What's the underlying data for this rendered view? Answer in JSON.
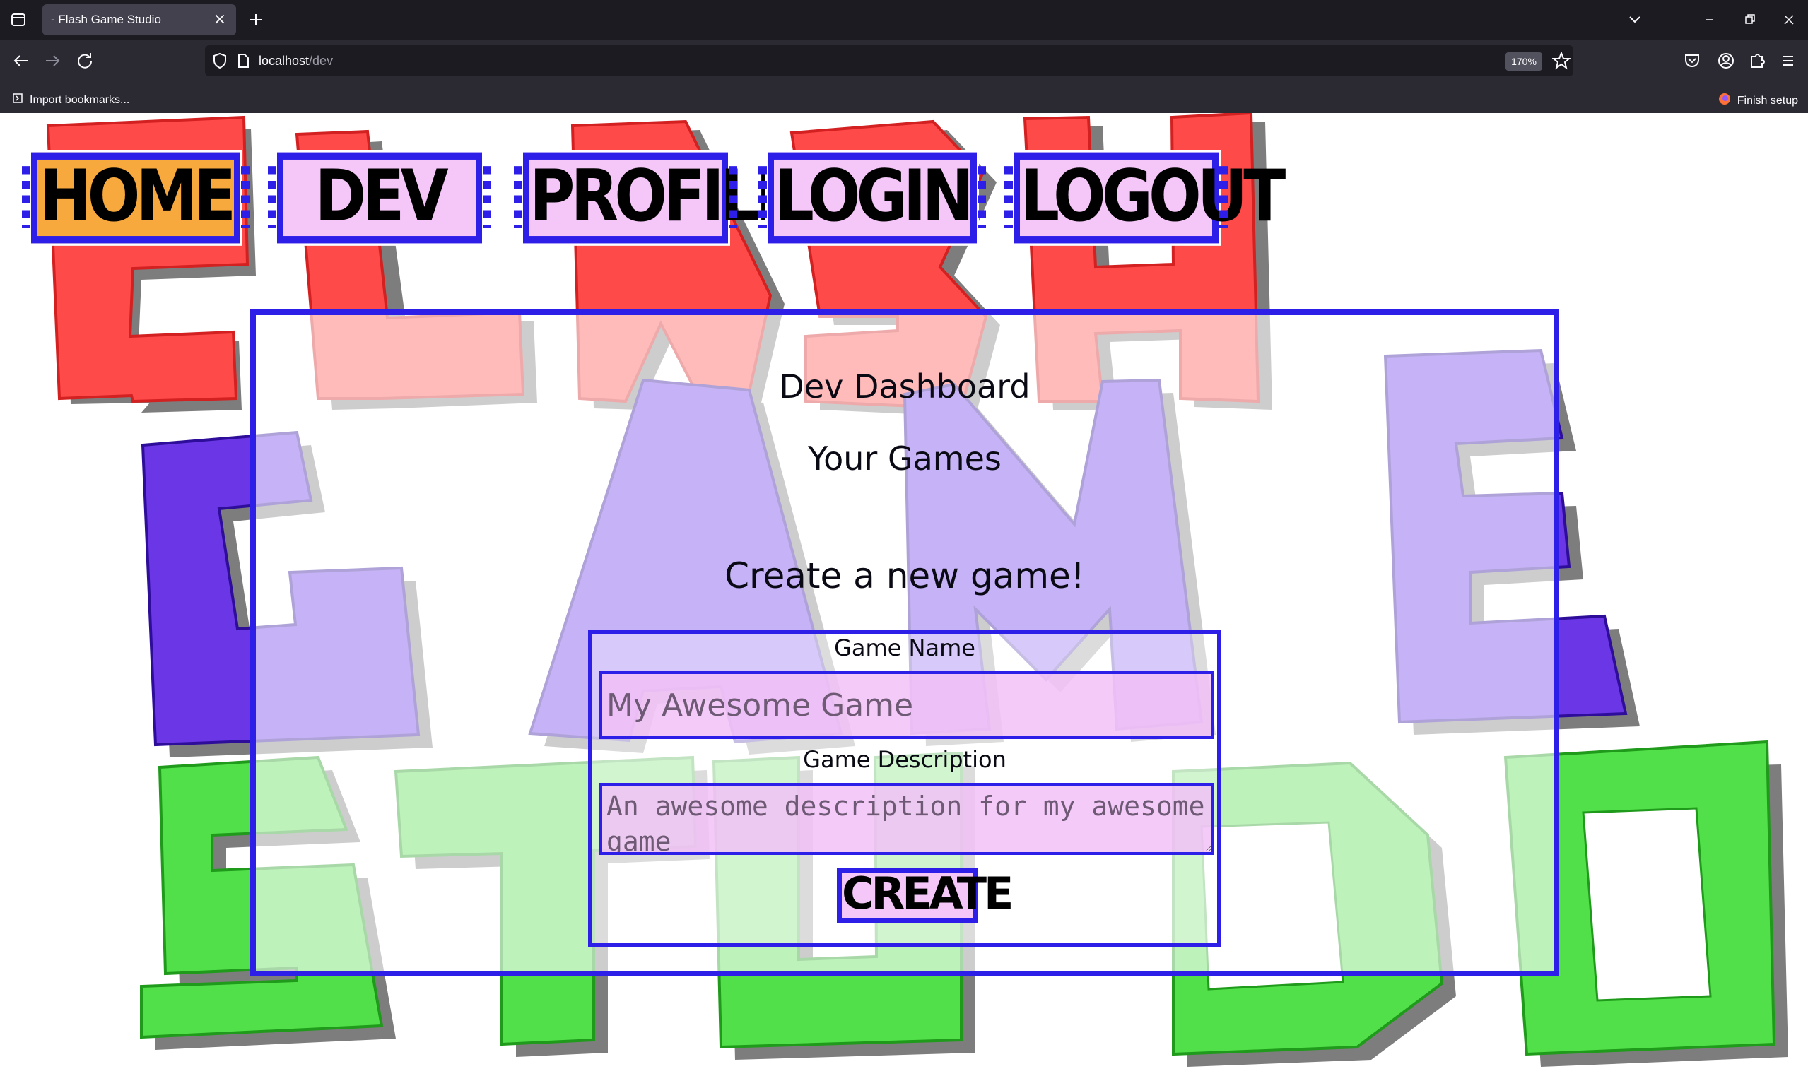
{
  "browser": {
    "tab_title": "- Flash Game Studio",
    "url_host": "localhost",
    "url_path": "/dev",
    "zoom": "170%",
    "bookmarks": {
      "import_label": "Import bookmarks...",
      "finish_setup_label": "Finish setup"
    },
    "icons": [
      "tab-list-icon",
      "close-icon",
      "plus-icon",
      "chevron-down-icon",
      "minimize-icon",
      "restore-icon",
      "window-close-icon",
      "back-arrow-icon",
      "forward-arrow-icon",
      "reload-icon",
      "shield-icon",
      "page-icon",
      "star-icon",
      "pocket-icon",
      "account-icon",
      "extensions-icon",
      "menu-icon",
      "import-icon",
      "firefox-icon"
    ]
  },
  "background": {
    "art_words": [
      "FLASH",
      "GAME",
      "STUDIO"
    ],
    "colors": {
      "flash": "#ff4a4a",
      "game": "#6a36e6",
      "studio": "#52e04a",
      "shadow": "#7d7d7d"
    }
  },
  "menu": {
    "home": "HOME",
    "dev": "DEV",
    "profile": "PROFILE",
    "login": "LOGIN",
    "logout": "LOGOUT",
    "active": "home"
  },
  "dashboard": {
    "title": "Dev Dashboard",
    "games_heading": "Your Games",
    "create_heading": "Create a new game!",
    "form": {
      "name_label": "Game Name",
      "name_placeholder": "My Awesome Game",
      "description_label": "Game Description",
      "description_placeholder": "An awesome description for my awesome game",
      "submit_label": "CREATE"
    }
  },
  "colors": {
    "accent_blue": "#2d1ee8",
    "button_pink": "#f5c6f8",
    "active_orange": "#f7a93d",
    "chrome_dark": "#1c1b22"
  }
}
